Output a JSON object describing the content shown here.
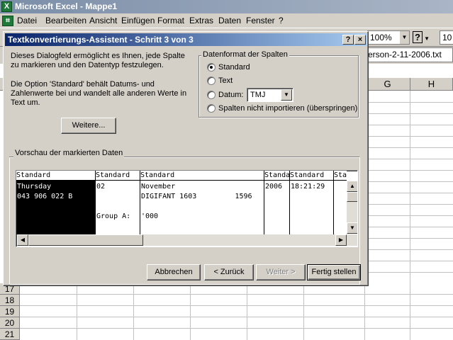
{
  "app": {
    "title": "Microsoft Excel - Mappe1",
    "icon": "X"
  },
  "menu": [
    "Datei",
    "Bearbeiten",
    "Ansicht",
    "Einfügen",
    "Format",
    "Extras",
    "Daten",
    "Fenster",
    "?"
  ],
  "toolbar": {
    "zoom": "100%",
    "font_size": "10",
    "help_glyph": "?"
  },
  "formula_bar": {
    "text": "erson-2-11-2006.txt"
  },
  "sheet": {
    "columns": [
      "G",
      "H"
    ],
    "rows": [
      "17",
      "18",
      "19",
      "20",
      "21"
    ]
  },
  "dialog": {
    "title": "Textkonvertierungs-Assistent - Schritt 3 von 3",
    "help_btn": "?",
    "close_btn": "×",
    "intro_text": "Dieses Dialogfeld ermöglicht es Ihnen, jede Spalte zu markieren und den Datentyp festzulegen.",
    "info_text": "Die Option 'Standard' behält Datums- und Zahlenwerte bei und wandelt alle anderen Werte in Text um.",
    "more_button": "Weitere...",
    "format_group": {
      "label": "Datenformat der Spalten",
      "standard": "Standard",
      "text": "Text",
      "date": "Datum:",
      "date_value": "TMJ",
      "skip": "Spalten nicht importieren (überspringen)"
    },
    "preview": {
      "label": "Vorschau der markierten Daten",
      "columns": [
        {
          "header": "Standard",
          "lines": [
            "Thursday",
            "043 906 022 B",
            "",
            "",
            ""
          ]
        },
        {
          "header": "Standard",
          "lines": [
            "02",
            "",
            "",
            "Group A:",
            ""
          ]
        },
        {
          "header": "Standard",
          "lines": [
            "November",
            "DIGIFANT 1603         1596",
            "",
            "'000",
            ""
          ]
        },
        {
          "header": "Standard",
          "lines": [
            "2006",
            "",
            "",
            "",
            ""
          ]
        },
        {
          "header": "Standard",
          "lines": [
            "18:21:29",
            "",
            "",
            "",
            ""
          ]
        },
        {
          "header": "Standa",
          "lines": [
            "",
            "",
            "",
            "",
            ""
          ]
        }
      ]
    },
    "buttons": {
      "cancel": "Abbrechen",
      "back": "< Zurück",
      "next": "Weiter >",
      "finish": "Fertig stellen"
    }
  },
  "colors": {
    "title_active": "#0a246a",
    "title_gradient_end": "#a6caf0",
    "face": "#d4d0c8"
  }
}
